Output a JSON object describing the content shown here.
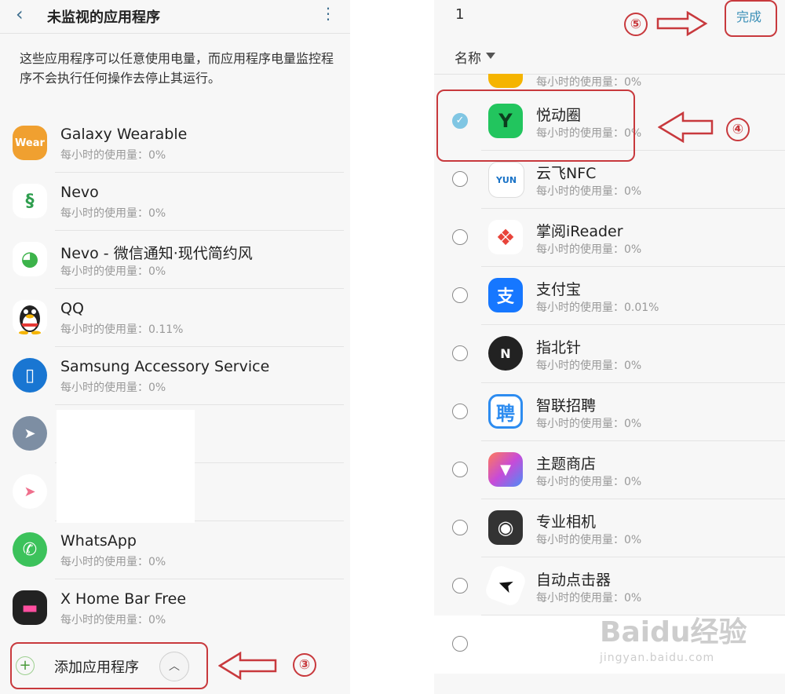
{
  "left": {
    "title": "未监视的应用程序",
    "description": "这些应用程序可以任意使用电量，而应用程序电量监控程序不会执行任何操作去停止其运行。",
    "apps": [
      {
        "name": "Galaxy Wearable",
        "usage": "每小时的使用量：0%",
        "icon": "wear-icon",
        "icon_text": "Wear",
        "color": "#f0a030"
      },
      {
        "name": "Nevo",
        "usage": "每小时的使用量：0%",
        "icon": "dna-icon",
        "icon_text": "§",
        "color": "#2f9e4f"
      },
      {
        "name": "Nevo - 微信通知·现代简约风",
        "usage": "每小时的使用量：0%",
        "icon": "wechat-icon",
        "icon_text": "◕",
        "color": "#3cb34a"
      },
      {
        "name": "QQ",
        "usage": "每小时的使用量：0.11%",
        "icon": "penguin-icon",
        "icon_text": "●",
        "color": "#222222"
      },
      {
        "name": "Samsung Accessory Service",
        "usage": "每小时的使用量：0%",
        "icon": "accessory-icon",
        "icon_text": "▯",
        "color": "#1976d2"
      },
      {
        "name": "",
        "usage": "",
        "icon": "paper-plane-icon",
        "icon_text": "➤",
        "color": "#7d8ea3"
      },
      {
        "name": "",
        "usage": "",
        "icon": "pink-plane-icon",
        "icon_text": "➤",
        "color": "#ef6f8c"
      },
      {
        "name": "WhatsApp",
        "usage": "每小时的使用量：0%",
        "icon": "whatsapp-icon",
        "icon_text": "✆",
        "color": "#3cc25b"
      },
      {
        "name": "X Home Bar Free",
        "usage": "每小时的使用量：0%",
        "icon": "homebar-icon",
        "icon_text": "▬",
        "color": "#222222"
      }
    ],
    "add_label": "添加应用程序",
    "step": "③"
  },
  "right": {
    "count": "1",
    "done_label": "完成",
    "sort_label": "名称",
    "step_done": "⑤",
    "step_select": "④",
    "partial_usage": "每小时的使用量：0%",
    "apps": [
      {
        "name": "悦动圈",
        "usage": "每小时的使用量：0%",
        "checked": true,
        "icon": "yuedongquan-icon",
        "icon_text": "Y",
        "color": "#22c55e"
      },
      {
        "name": "云飞NFC",
        "usage": "每小时的使用量：0%",
        "checked": false,
        "icon": "yunfei-nfc-icon",
        "icon_text": "YUN",
        "color": "#ffffff"
      },
      {
        "name": "掌阅iReader",
        "usage": "每小时的使用量：0%",
        "checked": false,
        "icon": "ireader-icon",
        "icon_text": "❖",
        "color": "#e8443a"
      },
      {
        "name": "支付宝",
        "usage": "每小时的使用量：0.01%",
        "checked": false,
        "icon": "alipay-icon",
        "icon_text": "支",
        "color": "#1677ff"
      },
      {
        "name": "指北针",
        "usage": "每小时的使用量：0%",
        "checked": false,
        "icon": "compass-icon",
        "icon_text": "N",
        "color": "#222222"
      },
      {
        "name": "智联招聘",
        "usage": "每小时的使用量：0%",
        "checked": false,
        "icon": "zhaopin-icon",
        "icon_text": "聘",
        "color": "#2d8cf0"
      },
      {
        "name": "主题商店",
        "usage": "每小时的使用量：0%",
        "checked": false,
        "icon": "theme-store-icon",
        "icon_text": "▼",
        "color": "#ff6b6b"
      },
      {
        "name": "专业相机",
        "usage": "每小时的使用量：0%",
        "checked": false,
        "icon": "camera-icon",
        "icon_text": "◉",
        "color": "#333333"
      },
      {
        "name": "自动点击器",
        "usage": "每小时的使用量：0%",
        "checked": false,
        "icon": "auto-clicker-icon",
        "icon_text": "➤",
        "color": "#ffffff"
      },
      {
        "name": "",
        "usage": "",
        "checked": false,
        "icon": "blank-icon",
        "icon_text": "",
        "color": "#ffffff"
      }
    ]
  },
  "watermark": {
    "main": "Baidu经验",
    "sub": "jingyan.baidu.com"
  },
  "colors": {
    "highlight": "#c8393d",
    "accent": "#3a8fb7",
    "check": "#80c6e3"
  }
}
